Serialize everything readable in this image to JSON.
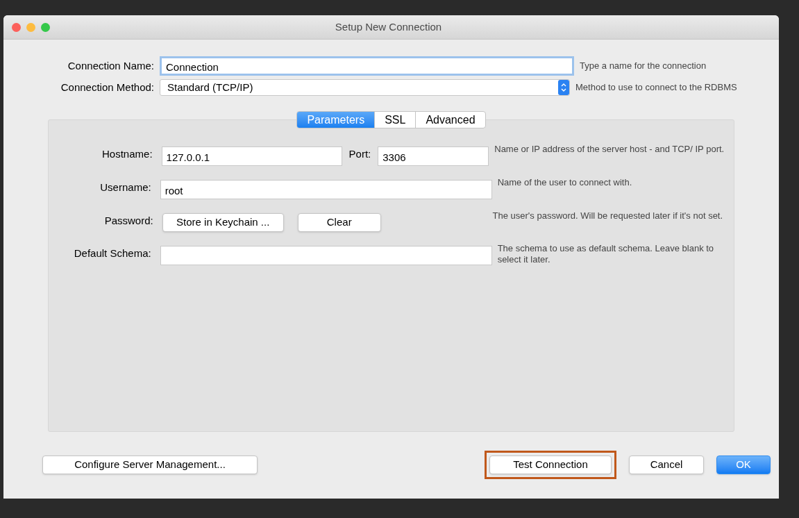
{
  "window": {
    "title": "Setup New Connection"
  },
  "fields": [
    {
      "kind": "text",
      "label": "Connection Name:",
      "value": "Connection",
      "focused": true,
      "hint": "Type a name for the connection"
    },
    {
      "kind": "select",
      "label": "Connection Method:",
      "value": "Standard (TCP/IP)",
      "focused": false,
      "hint": "Method to use to connect to the RDBMS"
    }
  ],
  "tabs": [
    {
      "label": "Parameters",
      "selected": true
    },
    {
      "label": "SSL",
      "selected": false
    },
    {
      "label": "Advanced",
      "selected": false
    }
  ],
  "parameters": [
    {
      "kind": "hostport",
      "label": "Hostname:",
      "value": "127.0.0.1",
      "port_label": "Port:",
      "port_value": "3306",
      "hint": "Name or IP address of the server host - and TCP/ IP port."
    },
    {
      "kind": "text",
      "label": "Username:",
      "value": "root",
      "hint": "Name of the user to connect with."
    },
    {
      "kind": "buttons",
      "label": "Password:",
      "buttons": [
        "Store in Keychain ...",
        "Clear"
      ],
      "hint": "The user's password. Will be requested later if it's not set."
    },
    {
      "kind": "text",
      "label": "Default Schema:",
      "hint": "The schema to use as default schema. Leave blank to select it later."
    }
  ],
  "footer": {
    "left_button": "Configure Server Management...",
    "buttons": [
      {
        "label": "Test Connection",
        "default": false,
        "highlighted": true
      },
      {
        "label": "Cancel",
        "default": false,
        "highlighted": false
      },
      {
        "label": "OK",
        "default": true,
        "highlighted": false
      }
    ]
  }
}
